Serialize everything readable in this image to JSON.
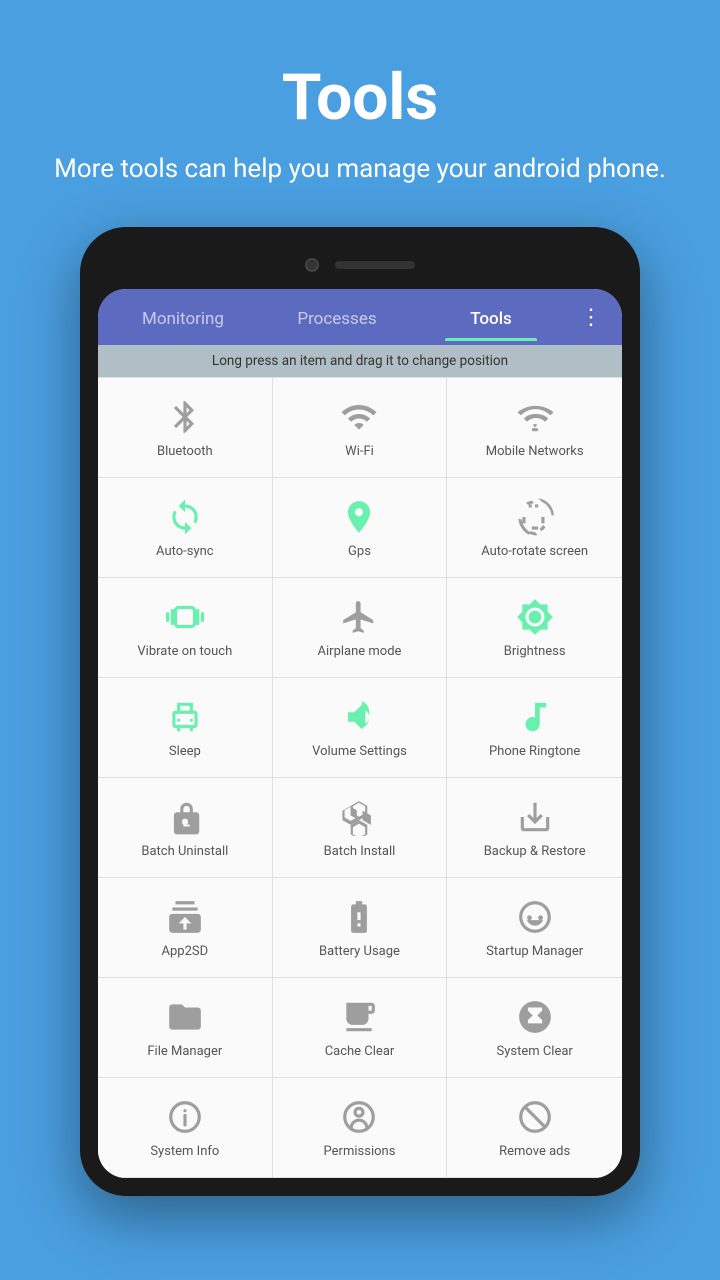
{
  "header": {
    "title": "Tools",
    "subtitle": "More tools can help you manage your android phone."
  },
  "tabs": [
    {
      "label": "Monitoring",
      "active": false
    },
    {
      "label": "Processes",
      "active": false
    },
    {
      "label": "Tools",
      "active": true
    }
  ],
  "hint": "Long press an item and drag it to change position",
  "tools": [
    {
      "label": "Bluetooth",
      "icon": "bluetooth",
      "color": "gray"
    },
    {
      "label": "Wi-Fi",
      "icon": "wifi",
      "color": "gray"
    },
    {
      "label": "Mobile Networks",
      "icon": "mobile_networks",
      "color": "gray"
    },
    {
      "label": "Auto-sync",
      "icon": "autosync",
      "color": "green"
    },
    {
      "label": "Gps",
      "icon": "gps",
      "color": "green"
    },
    {
      "label": "Auto-rotate screen",
      "icon": "autorotate",
      "color": "gray"
    },
    {
      "label": "Vibrate on touch",
      "icon": "vibrate",
      "color": "green"
    },
    {
      "label": "Airplane mode",
      "icon": "airplane",
      "color": "gray"
    },
    {
      "label": "Brightness",
      "icon": "brightness",
      "color": "green"
    },
    {
      "label": "Sleep",
      "icon": "sleep",
      "color": "green"
    },
    {
      "label": "Volume Settings",
      "icon": "volume",
      "color": "green"
    },
    {
      "label": "Phone Ringtone",
      "icon": "ringtone",
      "color": "green"
    },
    {
      "label": "Batch Uninstall",
      "icon": "batch_uninstall",
      "color": "gray"
    },
    {
      "label": "Batch Install",
      "icon": "batch_install",
      "color": "gray"
    },
    {
      "label": "Backup & Restore",
      "icon": "backup",
      "color": "gray"
    },
    {
      "label": "App2SD",
      "icon": "app2sd",
      "color": "gray"
    },
    {
      "label": "Battery Usage",
      "icon": "battery",
      "color": "gray"
    },
    {
      "label": "Startup Manager",
      "icon": "startup",
      "color": "gray"
    },
    {
      "label": "File Manager",
      "icon": "file",
      "color": "gray"
    },
    {
      "label": "Cache Clear",
      "icon": "cache",
      "color": "gray"
    },
    {
      "label": "System Clear",
      "icon": "system_clear",
      "color": "gray"
    },
    {
      "label": "System Info",
      "icon": "system_info",
      "color": "gray"
    },
    {
      "label": "Permissions",
      "icon": "permissions",
      "color": "gray"
    },
    {
      "label": "Remove ads",
      "icon": "remove_ads",
      "color": "gray"
    }
  ],
  "more_icon": "⋮"
}
